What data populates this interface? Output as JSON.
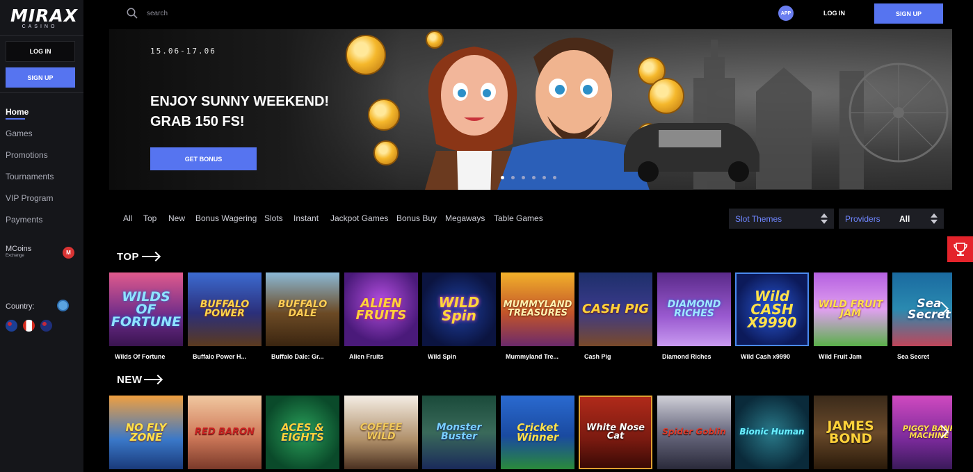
{
  "brand": {
    "name": "MIRAX",
    "sub": "CASINO"
  },
  "sidebar": {
    "login_label": "LOG IN",
    "signup_label": "SIGN UP",
    "nav": [
      {
        "label": "Home"
      },
      {
        "label": "Games"
      },
      {
        "label": "Promotions"
      },
      {
        "label": "Tournaments"
      },
      {
        "label": "VIP Program"
      },
      {
        "label": "Payments"
      }
    ],
    "mcoins": {
      "label": "MCoins",
      "sub": "Exchange"
    },
    "country_label": "Country:"
  },
  "header": {
    "search_placeholder": "search",
    "app_label": "APP",
    "login_label": "LOG IN",
    "signup_label": "SIGN UP"
  },
  "hero": {
    "date": "15.06-17.06",
    "title_line1": "ENJOY SUNNY WEEKEND!",
    "title_line2": "GRAB 150 FS!",
    "button_label": "GET BONUS",
    "slides_total": 6,
    "active_slide": 1
  },
  "filters": {
    "tabs": [
      "All",
      "Top",
      "New",
      "Bonus Wagering",
      "Slots",
      "Instant",
      "Jackpot Games",
      "Bonus Buy",
      "Megaways",
      "Table Games"
    ],
    "slot_themes_label": "Slot Themes",
    "providers_label": "Providers",
    "providers_value": "All"
  },
  "sections": {
    "top": {
      "title": "TOP",
      "games": [
        {
          "name": "Wilds Of Fortune",
          "art": "WILDS OF FORTUNE"
        },
        {
          "name": "Buffalo Power H...",
          "art": "BUFFALO POWER"
        },
        {
          "name": "Buffalo Dale: Gr...",
          "art": "BUFFALO DALE"
        },
        {
          "name": "Alien Fruits",
          "art": "ALIEN FRUITS"
        },
        {
          "name": "Wild Spin",
          "art": "WILD Spin"
        },
        {
          "name": "Mummyland Tre...",
          "art": "MUMMYLAND TREASURES"
        },
        {
          "name": "Cash Pig",
          "art": "CASH PIG"
        },
        {
          "name": "Diamond Riches",
          "art": "DIAMOND RICHES"
        },
        {
          "name": "Wild Cash x9990",
          "art": "Wild CASH X9990"
        },
        {
          "name": "Wild Fruit Jam",
          "art": "WILD FRUIT JAM"
        },
        {
          "name": "Sea Secret",
          "art": "Sea Secret"
        }
      ]
    },
    "new": {
      "title": "NEW",
      "games": [
        {
          "art": "NO FLY ZONE"
        },
        {
          "art": "RED BARON"
        },
        {
          "art": "ACES & EIGHTS"
        },
        {
          "art": "COFFEE WILD"
        },
        {
          "art": "Monster Buster"
        },
        {
          "art": "Cricket Winner"
        },
        {
          "art": "White Nose Cat"
        },
        {
          "art": "Spider Goblin"
        },
        {
          "art": "Bionic Human"
        },
        {
          "art": "JAMES BOND"
        },
        {
          "art": "PIGGY BANK MACHINE"
        }
      ]
    }
  },
  "colors": {
    "accent": "#5674f0",
    "sidebar_bg": "#15161a",
    "promo_red": "#e4232b"
  }
}
